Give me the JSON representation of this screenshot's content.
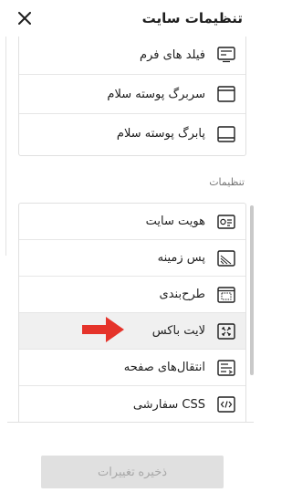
{
  "header": {
    "title": "تنظیمات سایت",
    "close_icon": "close-icon"
  },
  "top_group": {
    "items": [
      {
        "label": "فیلد های فرم",
        "icon": "form-fields-icon"
      },
      {
        "label": "سربرگ پوسته سلام",
        "icon": "header-icon"
      },
      {
        "label": "پابرگ پوسته سلام",
        "icon": "footer-icon"
      }
    ]
  },
  "settings_section": {
    "label": "تنظیمات",
    "items": [
      {
        "label": "هویت سایت",
        "icon": "id-card-icon"
      },
      {
        "label": "پس زمینه",
        "icon": "background-icon"
      },
      {
        "label": "طرح‌بندی",
        "icon": "layout-icon"
      },
      {
        "label": "لایت باکس",
        "icon": "lightbox-icon"
      },
      {
        "label": "انتقال‌های صفحه",
        "icon": "page-transitions-icon"
      },
      {
        "label": "CSS سفارشی",
        "icon": "custom-css-icon"
      }
    ]
  },
  "footer": {
    "save_label": "ذخیره تغییرات"
  },
  "colors": {
    "accent_arrow": "#e5332a",
    "disabled_button_bg": "#e0e0e0",
    "active_row_bg": "#f0f0f0"
  }
}
